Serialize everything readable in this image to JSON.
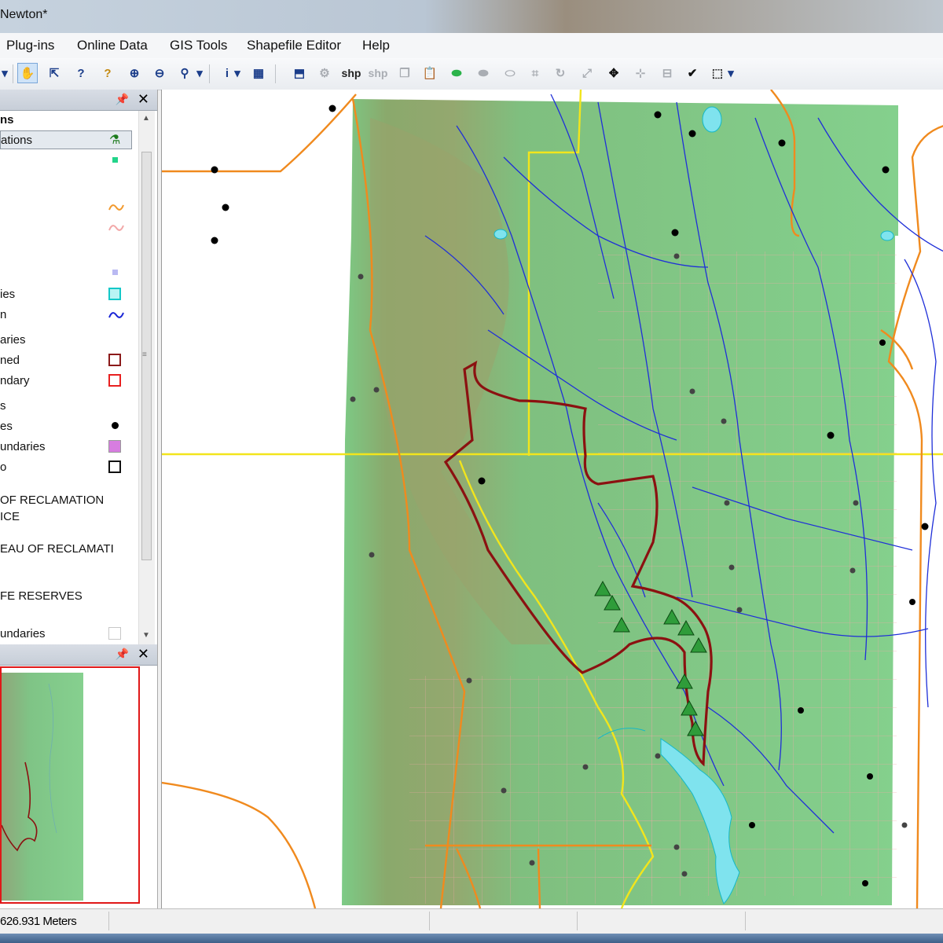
{
  "window": {
    "title": "Newton*"
  },
  "menu": [
    "Plug-ins",
    "Online Data",
    "GIS Tools",
    "Shapefile Editor",
    "Help"
  ],
  "toolbar": {
    "shp_label": "shp",
    "shp_label_2": "shp"
  },
  "legend": {
    "items": [
      {
        "label": "ns",
        "bold": true
      },
      {
        "label": "ations",
        "selected": true,
        "icon": "flask-icon"
      },
      {
        "label": "",
        "symbol": "point",
        "color": "#22d48a"
      },
      {
        "label": "",
        "symbol": "line",
        "color": "#f29a2e"
      },
      {
        "label": "",
        "symbol": "line",
        "color": "#f2a8a8"
      },
      {
        "label": "",
        "symbol": "point",
        "color": "#b9b9f2"
      },
      {
        "label": "ies",
        "symbol": "box",
        "color": "#14c8c8"
      },
      {
        "label": "n",
        "symbol": "line",
        "color": "#1a26d6"
      },
      {
        "label": "aries"
      },
      {
        "label": "ned",
        "symbol": "box",
        "color": "#8b1a1a"
      },
      {
        "label": "ndary",
        "symbol": "box",
        "color": "#e82020"
      },
      {
        "label": "s"
      },
      {
        "label": "es",
        "symbol": "dot",
        "color": "#000000"
      },
      {
        "label": "undaries",
        "symbol": "fill",
        "color": "#d77de0"
      },
      {
        "label": "o",
        "symbol": "box",
        "color": "#111111"
      },
      {
        "label": "OF RECLAMATION"
      },
      {
        "label": "ICE"
      },
      {
        "label": "EAU OF RECLAMATI"
      },
      {
        "label": "FE RESERVES"
      },
      {
        "label": "undaries",
        "symbol": "box",
        "color": "#c8c8c8"
      }
    ]
  },
  "status": {
    "scale": "626.931 Meters"
  },
  "colors": {
    "terrain": "#7fc987",
    "stream": "#1f2fd8",
    "road": "#f4b0b0",
    "highway": "#f08a1e",
    "county_line": "#f2e51c",
    "watershed": "#8b1111",
    "lake": "#7fe3ee"
  }
}
